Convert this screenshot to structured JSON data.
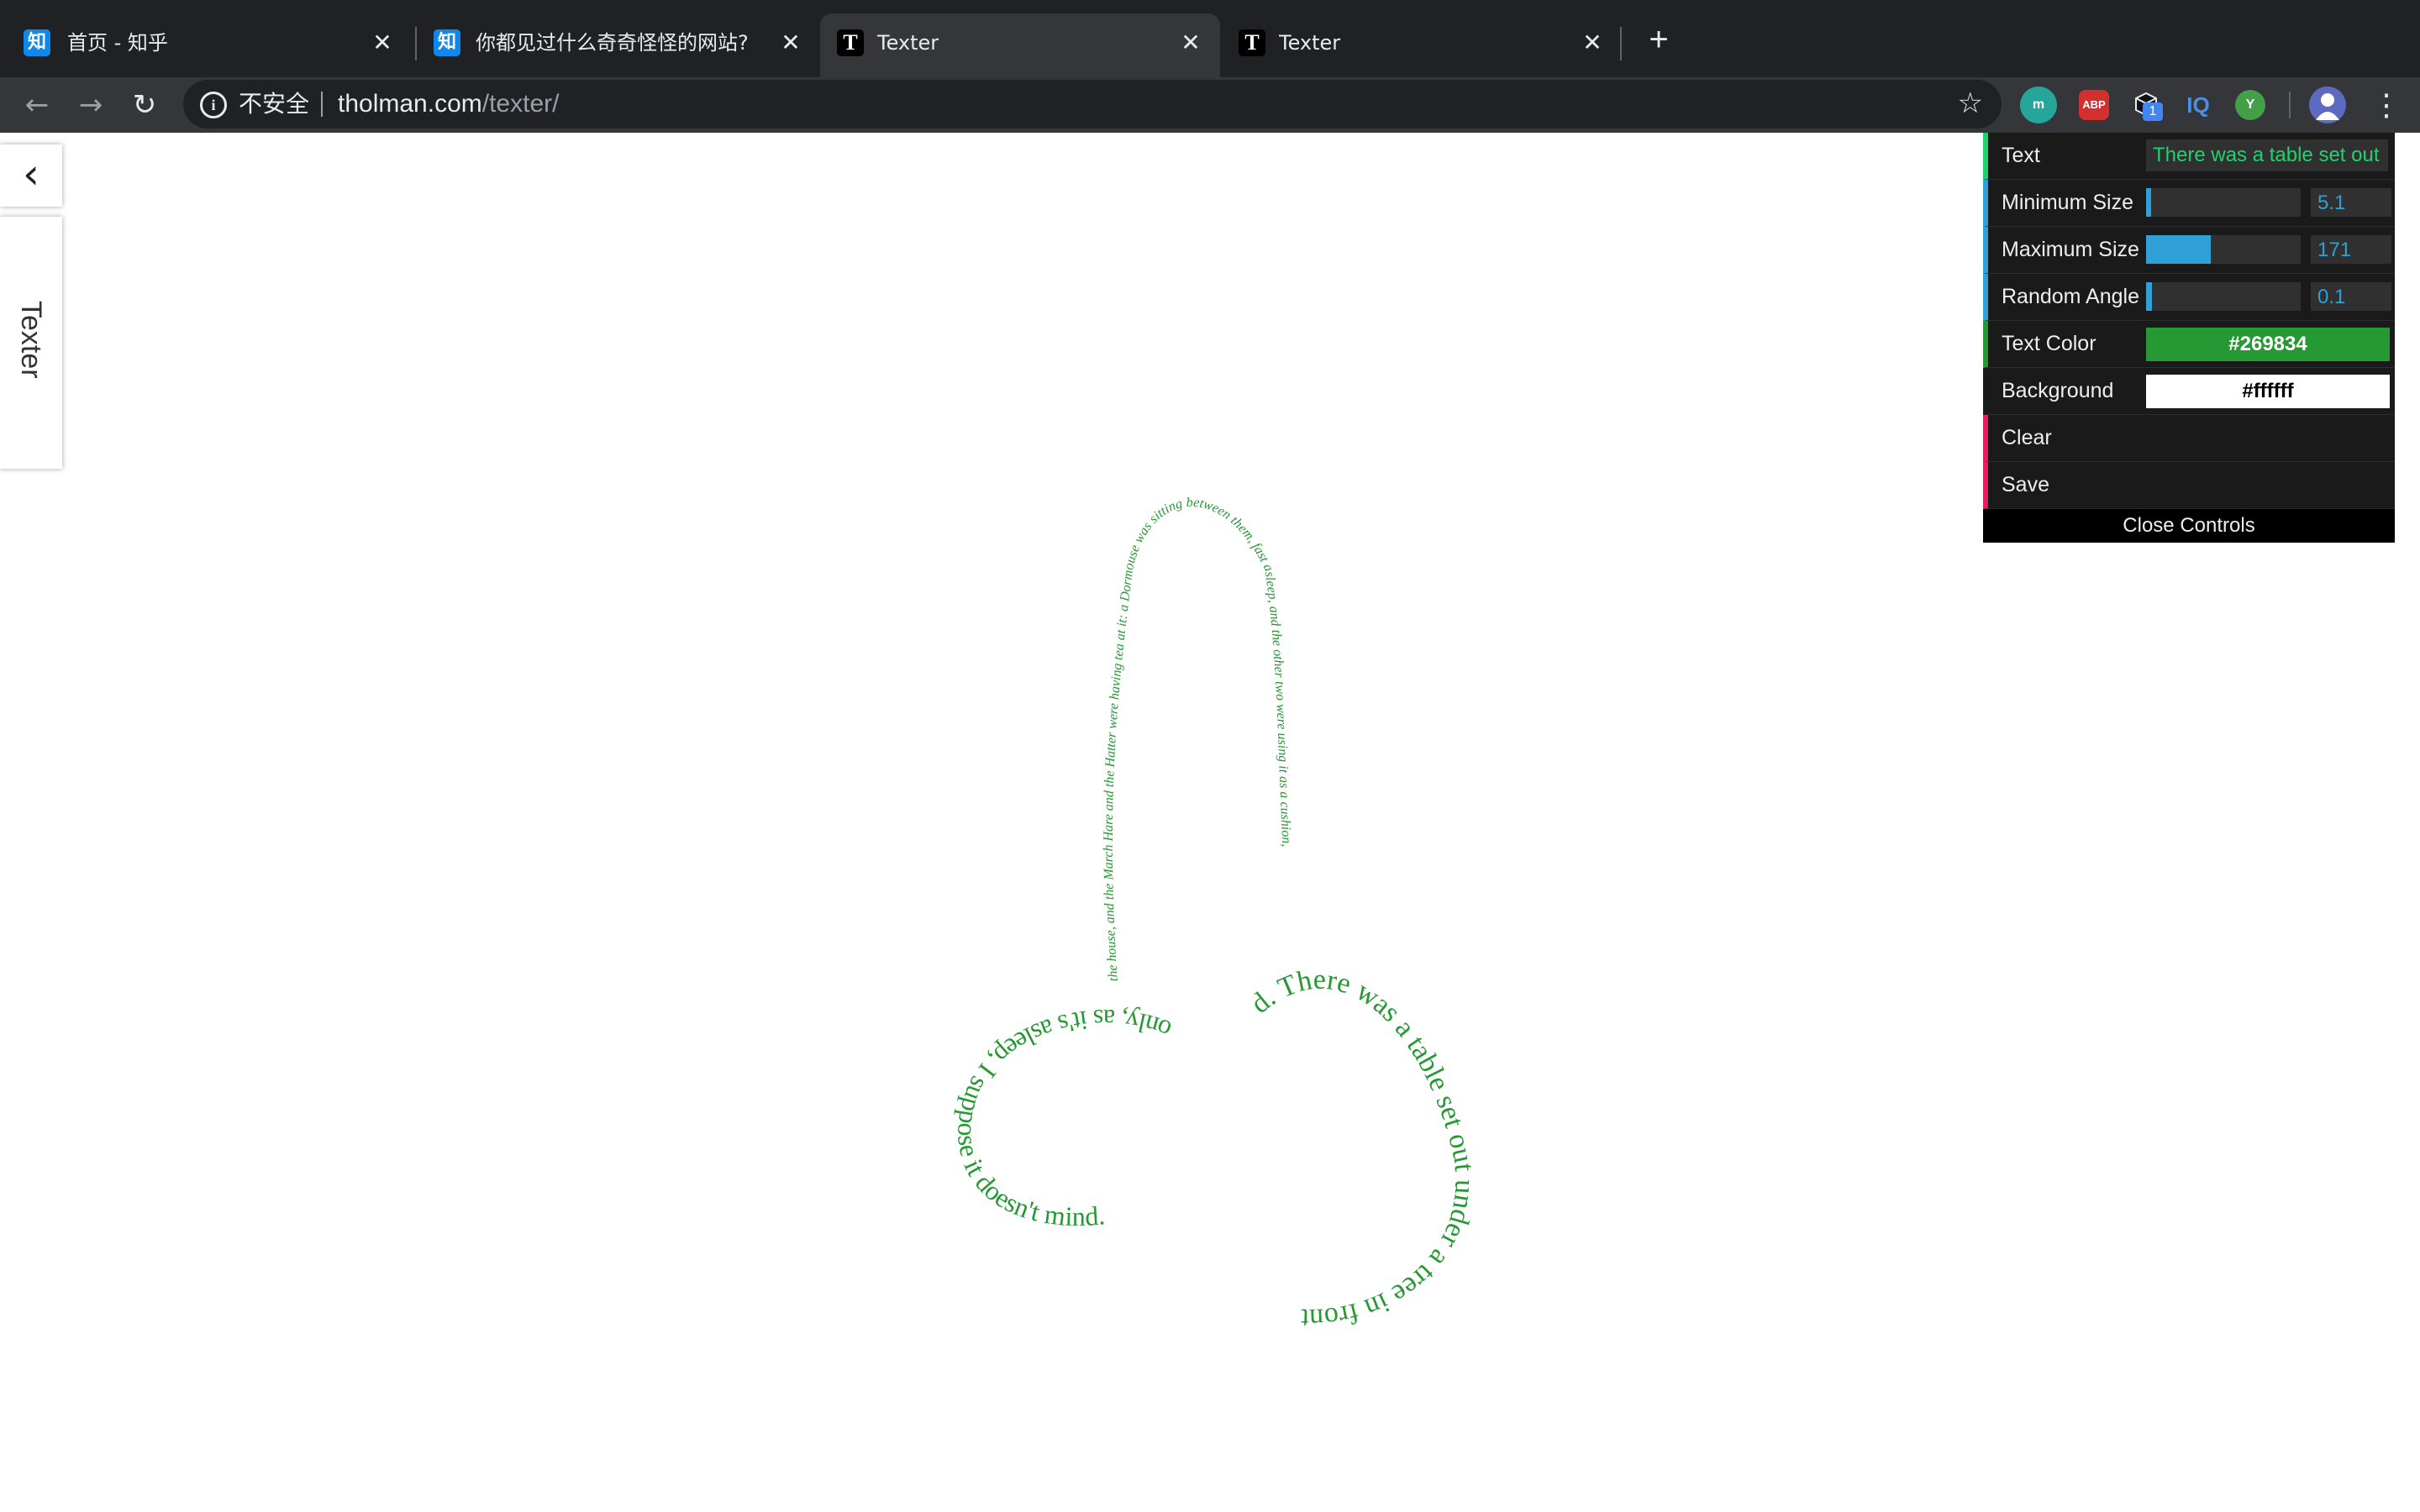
{
  "browser": {
    "tabs": [
      {
        "title": "首页 - 知乎",
        "favicon": "知",
        "active": false
      },
      {
        "title": "你都见过什么奇奇怪怪的网站?",
        "favicon": "知",
        "active": false
      },
      {
        "title": "Texter",
        "favicon": "T",
        "active": true
      },
      {
        "title": "Texter",
        "favicon": "T",
        "active": false
      }
    ],
    "close_glyph": "✕",
    "new_tab_glyph": "+",
    "security_label": "不安全",
    "url_host": "tholman.com",
    "url_path": "/texter/",
    "extensions": [
      {
        "name": "m-extension-icon",
        "label": "m",
        "color": "#26a69a"
      },
      {
        "name": "adblock-plus-icon",
        "label": "ABP",
        "color": "#d32f2f"
      },
      {
        "name": "cube-extension-icon",
        "label": "",
        "color": "#202124",
        "badge": "1"
      },
      {
        "name": "iq-extension-icon",
        "label": "IQ",
        "color": "#35363a"
      },
      {
        "name": "y-extension-icon",
        "label": "Y",
        "color": "#43a047"
      }
    ]
  },
  "page": {
    "side_tab_label": "Texter"
  },
  "controls": {
    "text_label": "Text",
    "text_value": "There was a table set out",
    "min_size_label": "Minimum Size",
    "min_size_value": "5.1",
    "min_size_fraction": 0.03,
    "max_size_label": "Maximum Size",
    "max_size_value": "171",
    "max_size_fraction": 0.42,
    "angle_label": "Random Angle",
    "angle_value": "0.1",
    "angle_fraction": 0.04,
    "text_color_label": "Text Color",
    "text_color_value": "#269834",
    "background_label": "Background",
    "background_value": "#ffffff",
    "clear_label": "Clear",
    "save_label": "Save",
    "close_label": "Close Controls"
  },
  "artwork": {
    "color": "#269834",
    "phrases": [
      "the house, and the March Hare and the Hatter were having tea at it: a Dormouse was sitting between them, fast asleep, and the other two were using it as a cushion,",
      "d. There was a table set out under a tree in front",
      "of the house, and the March Hare and the Hatter",
      "only, as it's asleep, I suppose it doesn't mind."
    ]
  }
}
